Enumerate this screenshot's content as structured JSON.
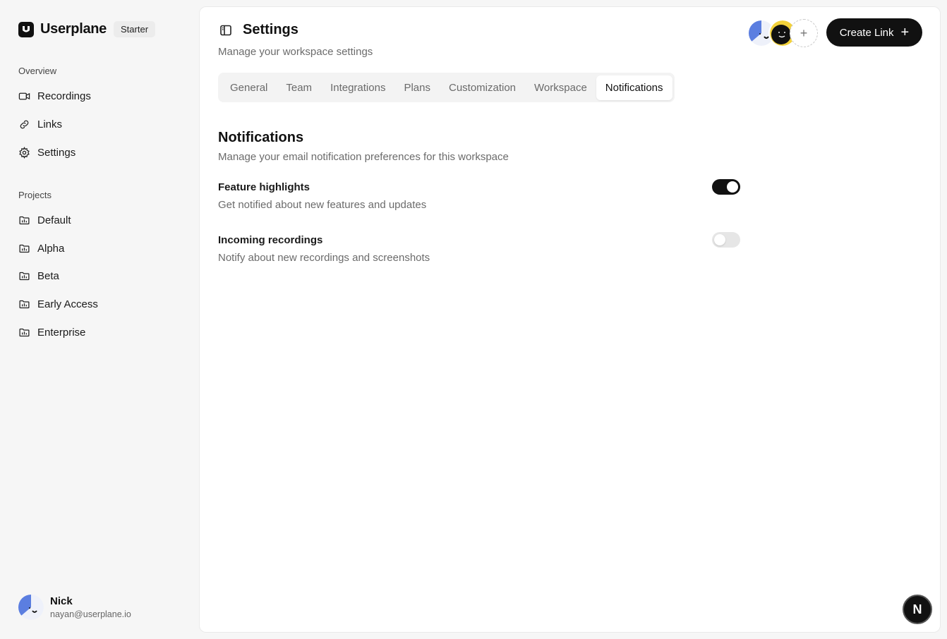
{
  "brand": {
    "name": "Userplane",
    "plan": "Starter"
  },
  "sidebar": {
    "overview_label": "Overview",
    "overview_items": [
      {
        "label": "Recordings",
        "icon": "video-icon"
      },
      {
        "label": "Links",
        "icon": "link-icon"
      },
      {
        "label": "Settings",
        "icon": "gear-icon"
      }
    ],
    "projects_label": "Projects",
    "projects": [
      {
        "label": "Default",
        "icon": "folder-icon"
      },
      {
        "label": "Alpha",
        "icon": "folder-icon"
      },
      {
        "label": "Beta",
        "icon": "folder-icon"
      },
      {
        "label": "Early Access",
        "icon": "folder-icon"
      },
      {
        "label": "Enterprise",
        "icon": "folder-icon"
      }
    ],
    "user": {
      "name": "Nick",
      "email": "nayan@userplane.io"
    }
  },
  "header": {
    "title": "Settings",
    "subtitle": "Manage your workspace settings",
    "create_link_label": "Create Link"
  },
  "tabs": [
    {
      "label": "General",
      "active": false
    },
    {
      "label": "Team",
      "active": false
    },
    {
      "label": "Integrations",
      "active": false
    },
    {
      "label": "Plans",
      "active": false
    },
    {
      "label": "Customization",
      "active": false
    },
    {
      "label": "Workspace",
      "active": false
    },
    {
      "label": "Notifications",
      "active": true
    }
  ],
  "notifications": {
    "title": "Notifications",
    "description": "Manage your email notification preferences for this workspace",
    "settings": [
      {
        "title": "Feature highlights",
        "description": "Get notified about new features and updates",
        "enabled": true
      },
      {
        "title": "Incoming recordings",
        "description": "Notify about new recordings and screenshots",
        "enabled": false
      }
    ]
  },
  "floating_badge": "N",
  "colors": {
    "primary": "#111111",
    "accent_blue": "#5b7ee0",
    "accent_yellow": "#f2d13a"
  }
}
